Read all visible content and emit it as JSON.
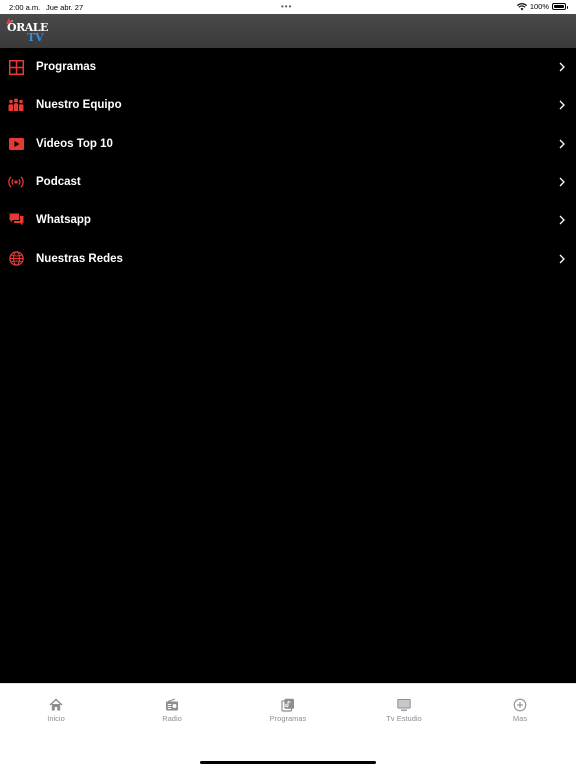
{
  "status_bar": {
    "time": "2:00 a.m.",
    "date": "Jue abr. 27",
    "dots": "•••",
    "battery": "100%"
  },
  "header": {
    "logo_top": "ÓRALE",
    "logo_bottom": "TV"
  },
  "menu": {
    "items": [
      {
        "label": "Programas",
        "icon": "grid-icon"
      },
      {
        "label": "Nuestro Equipo",
        "icon": "team-icon"
      },
      {
        "label": "Videos Top 10",
        "icon": "play-video-icon"
      },
      {
        "label": "Podcast",
        "icon": "broadcast-icon"
      },
      {
        "label": "Whatsapp",
        "icon": "chat-icon"
      },
      {
        "label": "Nuestras Redes",
        "icon": "globe-icon"
      }
    ]
  },
  "tab_bar": {
    "tabs": [
      {
        "label": "Inicio",
        "icon": "home-icon"
      },
      {
        "label": "Radio",
        "icon": "radio-icon"
      },
      {
        "label": "Programas",
        "icon": "library-icon"
      },
      {
        "label": "Tv  Estudio",
        "icon": "tv-icon"
      },
      {
        "label": "Mas",
        "icon": "plus-circle-icon"
      }
    ]
  },
  "colors": {
    "accent": "#e53935",
    "background": "#000000",
    "header": "#3f3f3f",
    "tab_inactive": "#8e8e93"
  }
}
